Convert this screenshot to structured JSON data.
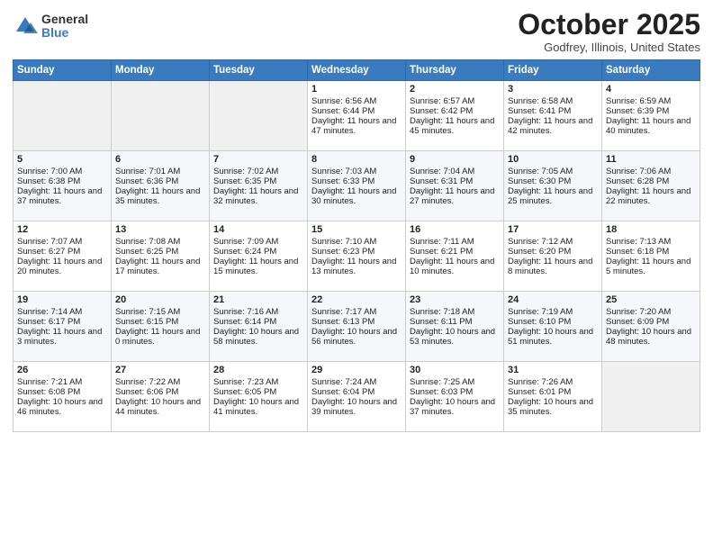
{
  "header": {
    "logo_general": "General",
    "logo_blue": "Blue",
    "month_title": "October 2025",
    "location": "Godfrey, Illinois, United States"
  },
  "days_of_week": [
    "Sunday",
    "Monday",
    "Tuesday",
    "Wednesday",
    "Thursday",
    "Friday",
    "Saturday"
  ],
  "weeks": [
    [
      {
        "day": "",
        "text": ""
      },
      {
        "day": "",
        "text": ""
      },
      {
        "day": "",
        "text": ""
      },
      {
        "day": "1",
        "text": "Sunrise: 6:56 AM\nSunset: 6:44 PM\nDaylight: 11 hours and 47 minutes."
      },
      {
        "day": "2",
        "text": "Sunrise: 6:57 AM\nSunset: 6:42 PM\nDaylight: 11 hours and 45 minutes."
      },
      {
        "day": "3",
        "text": "Sunrise: 6:58 AM\nSunset: 6:41 PM\nDaylight: 11 hours and 42 minutes."
      },
      {
        "day": "4",
        "text": "Sunrise: 6:59 AM\nSunset: 6:39 PM\nDaylight: 11 hours and 40 minutes."
      }
    ],
    [
      {
        "day": "5",
        "text": "Sunrise: 7:00 AM\nSunset: 6:38 PM\nDaylight: 11 hours and 37 minutes."
      },
      {
        "day": "6",
        "text": "Sunrise: 7:01 AM\nSunset: 6:36 PM\nDaylight: 11 hours and 35 minutes."
      },
      {
        "day": "7",
        "text": "Sunrise: 7:02 AM\nSunset: 6:35 PM\nDaylight: 11 hours and 32 minutes."
      },
      {
        "day": "8",
        "text": "Sunrise: 7:03 AM\nSunset: 6:33 PM\nDaylight: 11 hours and 30 minutes."
      },
      {
        "day": "9",
        "text": "Sunrise: 7:04 AM\nSunset: 6:31 PM\nDaylight: 11 hours and 27 minutes."
      },
      {
        "day": "10",
        "text": "Sunrise: 7:05 AM\nSunset: 6:30 PM\nDaylight: 11 hours and 25 minutes."
      },
      {
        "day": "11",
        "text": "Sunrise: 7:06 AM\nSunset: 6:28 PM\nDaylight: 11 hours and 22 minutes."
      }
    ],
    [
      {
        "day": "12",
        "text": "Sunrise: 7:07 AM\nSunset: 6:27 PM\nDaylight: 11 hours and 20 minutes."
      },
      {
        "day": "13",
        "text": "Sunrise: 7:08 AM\nSunset: 6:25 PM\nDaylight: 11 hours and 17 minutes."
      },
      {
        "day": "14",
        "text": "Sunrise: 7:09 AM\nSunset: 6:24 PM\nDaylight: 11 hours and 15 minutes."
      },
      {
        "day": "15",
        "text": "Sunrise: 7:10 AM\nSunset: 6:23 PM\nDaylight: 11 hours and 13 minutes."
      },
      {
        "day": "16",
        "text": "Sunrise: 7:11 AM\nSunset: 6:21 PM\nDaylight: 11 hours and 10 minutes."
      },
      {
        "day": "17",
        "text": "Sunrise: 7:12 AM\nSunset: 6:20 PM\nDaylight: 11 hours and 8 minutes."
      },
      {
        "day": "18",
        "text": "Sunrise: 7:13 AM\nSunset: 6:18 PM\nDaylight: 11 hours and 5 minutes."
      }
    ],
    [
      {
        "day": "19",
        "text": "Sunrise: 7:14 AM\nSunset: 6:17 PM\nDaylight: 11 hours and 3 minutes."
      },
      {
        "day": "20",
        "text": "Sunrise: 7:15 AM\nSunset: 6:15 PM\nDaylight: 11 hours and 0 minutes."
      },
      {
        "day": "21",
        "text": "Sunrise: 7:16 AM\nSunset: 6:14 PM\nDaylight: 10 hours and 58 minutes."
      },
      {
        "day": "22",
        "text": "Sunrise: 7:17 AM\nSunset: 6:13 PM\nDaylight: 10 hours and 56 minutes."
      },
      {
        "day": "23",
        "text": "Sunrise: 7:18 AM\nSunset: 6:11 PM\nDaylight: 10 hours and 53 minutes."
      },
      {
        "day": "24",
        "text": "Sunrise: 7:19 AM\nSunset: 6:10 PM\nDaylight: 10 hours and 51 minutes."
      },
      {
        "day": "25",
        "text": "Sunrise: 7:20 AM\nSunset: 6:09 PM\nDaylight: 10 hours and 48 minutes."
      }
    ],
    [
      {
        "day": "26",
        "text": "Sunrise: 7:21 AM\nSunset: 6:08 PM\nDaylight: 10 hours and 46 minutes."
      },
      {
        "day": "27",
        "text": "Sunrise: 7:22 AM\nSunset: 6:06 PM\nDaylight: 10 hours and 44 minutes."
      },
      {
        "day": "28",
        "text": "Sunrise: 7:23 AM\nSunset: 6:05 PM\nDaylight: 10 hours and 41 minutes."
      },
      {
        "day": "29",
        "text": "Sunrise: 7:24 AM\nSunset: 6:04 PM\nDaylight: 10 hours and 39 minutes."
      },
      {
        "day": "30",
        "text": "Sunrise: 7:25 AM\nSunset: 6:03 PM\nDaylight: 10 hours and 37 minutes."
      },
      {
        "day": "31",
        "text": "Sunrise: 7:26 AM\nSunset: 6:01 PM\nDaylight: 10 hours and 35 minutes."
      },
      {
        "day": "",
        "text": ""
      }
    ]
  ]
}
